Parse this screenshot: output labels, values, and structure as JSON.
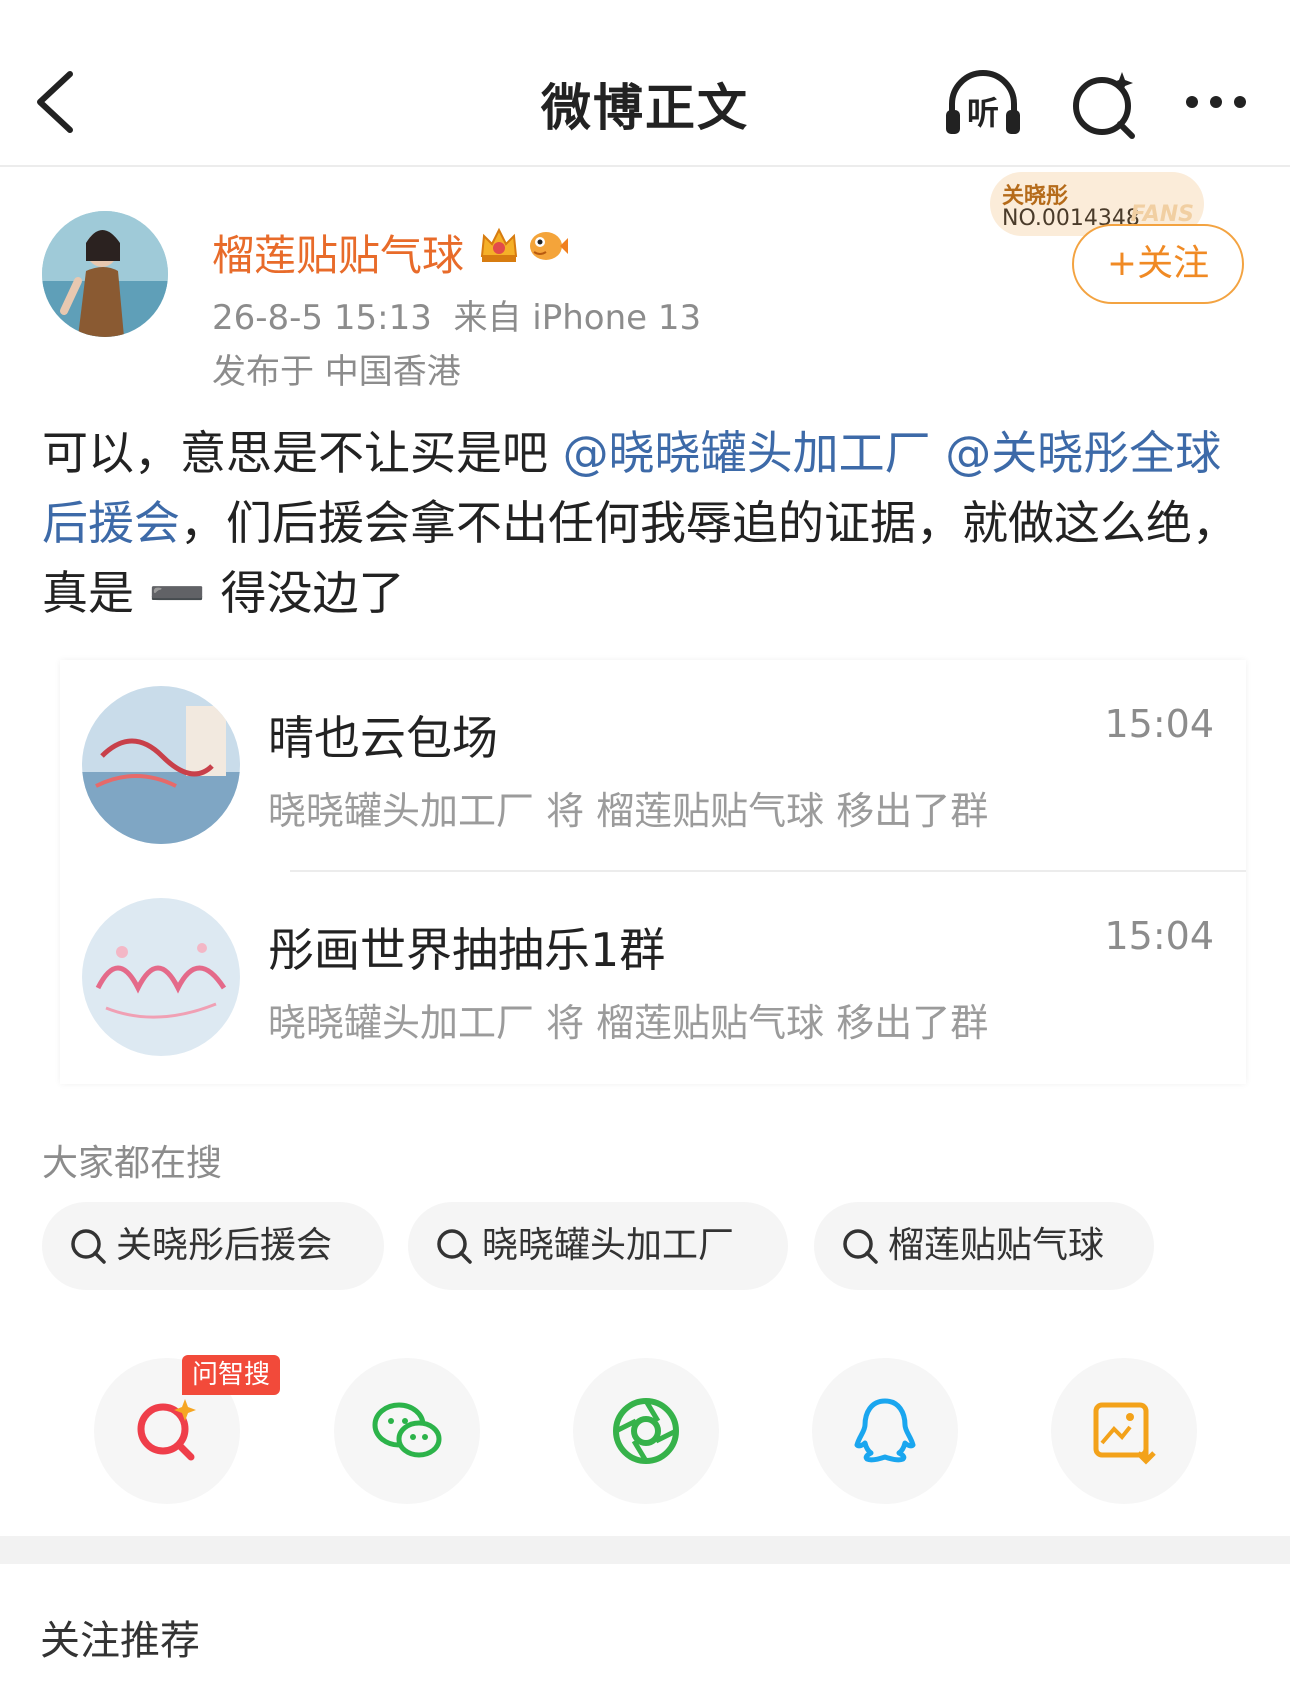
{
  "header": {
    "title": "微博正文",
    "listen_label": "听"
  },
  "author": {
    "name": "榴莲贴贴气球",
    "meta": "26-8-5 15:13  来自 iPhone 13",
    "location": "发布于 中国香港",
    "fans_title": "关晓彤",
    "fans_no": "NO.0014348",
    "fans_tag": "FANS",
    "follow_label": "+关注"
  },
  "post": {
    "text_1": "可以，意思是不让买是吧 ",
    "mention_1": "@晓晓罐头加工厂",
    "text_2": " ",
    "mention_2": "@关晓彤全球后援会",
    "text_3": "，们后援会拿不出任何我辱追的证据，就做这么绝，真是 ➖ 得没边了"
  },
  "chats": [
    {
      "name": "晴也云包场",
      "time": "15:04",
      "message": "晓晓罐头加工厂 将 榴莲贴贴气球 移出了群"
    },
    {
      "name": "彤画世界抽抽乐1群",
      "time": "15:04",
      "message": "晓晓罐头加工厂 将 榴莲贴贴气球 移出了群"
    }
  ],
  "search": {
    "heading": "大家都在搜",
    "chips": [
      "关晓彤后援会",
      "晓晓罐头加工厂",
      "榴莲贴贴气球"
    ]
  },
  "share": {
    "ai_label": "问智搜",
    "icons": [
      "ai-search-icon",
      "wechat-icon",
      "moments-icon",
      "qq-icon",
      "save-image-icon"
    ]
  },
  "section": {
    "recommend_title": "关注推荐"
  },
  "colors": {
    "accent_orange": "#f08a24",
    "mention_blue": "#3d6aa8",
    "name_orange": "#e86b2a"
  }
}
